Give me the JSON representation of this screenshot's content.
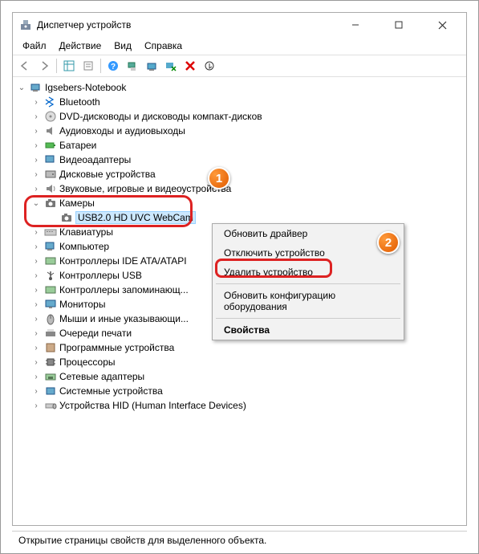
{
  "window": {
    "title": "Диспетчер устройств"
  },
  "menu": {
    "file": "Файл",
    "action": "Действие",
    "view": "Вид",
    "help": "Справка"
  },
  "tree": {
    "root": "Igsebers-Notebook",
    "bluetooth": "Bluetooth",
    "dvd": "DVD-дисководы и дисководы компакт-дисков",
    "audio": "Аудиовходы и аудиовыходы",
    "battery": "Батареи",
    "video": "Видеоадаптеры",
    "disk": "Дисковые устройства",
    "sound_game": "Звуковые, игровые и видеоустройства",
    "cameras": "Камеры",
    "webcam": "USB2.0 HD UVC WebCam",
    "keyboards": "Клавиатуры",
    "computer": "Компьютер",
    "ide": "Контроллеры IDE ATA/ATAPI",
    "usb": "Контроллеры USB",
    "storage_ctrl": "Контроллеры запоминающ...",
    "monitors": "Мониторы",
    "mice": "Мыши и иные указывающи...",
    "print_queue": "Очереди печати",
    "software_dev": "Программные устройства",
    "cpu": "Процессоры",
    "net": "Сетевые адаптеры",
    "system": "Системные устройства",
    "hid": "Устройства HID (Human Interface Devices)"
  },
  "ctx": {
    "update_driver": "Обновить драйвер",
    "disable": "Отключить устройство",
    "uninstall": "Удалить устройство",
    "scan": "Обновить конфигурацию оборудования",
    "properties": "Свойства"
  },
  "callouts": {
    "c1": "1",
    "c2": "2"
  },
  "status": "Открытие страницы свойств для выделенного объекта."
}
